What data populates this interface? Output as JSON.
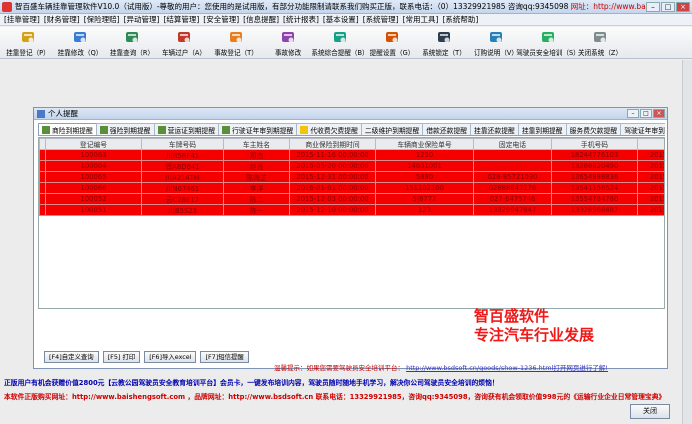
{
  "window": {
    "title_main": "智百盛车辆挂靠管理软件V10.0（试用版）-尊敬的用户：您使用的是试用版，有部分功能限制请联系我们购买正版，联系电话：（0）13329921985  咨询qq:9345098",
    "title_url_label": "网址：http://www.baishengsoft.com"
  },
  "menu": [
    "[挂靠管理]",
    "[财务管理]",
    "[保险理赔]",
    "[异动管理]",
    "[结算管理]",
    "[安全管理]",
    "[信息提醒]",
    "[统计报表]",
    "[基本设置]",
    "[系统管理]",
    "[常用工具]",
    "[系统帮助]"
  ],
  "toolbar": [
    {
      "label": "挂靠登记（P）",
      "icon": "folder-plus-icon"
    },
    {
      "label": "挂靠修改（Q）",
      "icon": "edit-icon"
    },
    {
      "label": "挂靠查询（R）",
      "icon": "magnifier-icon"
    },
    {
      "label": "车辆过户（A）",
      "icon": "car-transfer-icon"
    },
    {
      "label": "事故登记（T）",
      "icon": "accident-icon"
    },
    {
      "label": "事故修改",
      "icon": "accident-edit-icon"
    },
    {
      "label": "系统综合提醒（B）",
      "icon": "reminder-icon"
    },
    {
      "label": "提醒设置（G）",
      "icon": "bell-settings-icon"
    },
    {
      "label": "系统锁定（T）",
      "icon": "lock-icon"
    },
    {
      "label": "订购说明（V）",
      "icon": "info-icon"
    },
    {
      "label": "驾驶员安全培训（S）",
      "icon": "training-icon"
    },
    {
      "label": "关闭系统（Z）",
      "icon": "power-icon"
    }
  ],
  "child_window": {
    "title": "个人提醒",
    "tabs": [
      {
        "label": "商险到期提醒",
        "icon": "doc-icon"
      },
      {
        "label": "强险到期提醒",
        "icon": "doc-icon"
      },
      {
        "label": "营运证到期提醒",
        "icon": "doc-icon"
      },
      {
        "label": "行驶证年审到期提醒",
        "icon": "doc-icon"
      },
      {
        "label": "代收费欠费提醒",
        "icon": "warning-icon"
      },
      {
        "label": "二级维护到期提醒",
        "icon": "none"
      },
      {
        "label": "借款还款提醒",
        "icon": "none"
      },
      {
        "label": "挂靠还款提醒",
        "icon": "none"
      },
      {
        "label": "挂靠到期提醒",
        "icon": "none"
      },
      {
        "label": "服务费欠款提醒",
        "icon": "none"
      },
      {
        "label": "驾驶证年审到",
        "icon": "none"
      }
    ],
    "columns": [
      "登记编号",
      "车牌号码",
      "车主姓名",
      "商业保险到期时间",
      "车辆商业保险单号",
      "固定电话",
      "手机号码",
      ""
    ],
    "rows": [
      [
        "100063",
        "川R5RF41",
        "邓杰",
        "2015-11-16 00:00:00",
        "1250",
        "",
        "18244776103",
        "2015"
      ],
      [
        "100064",
        "晋A8D641",
        "赵亮",
        "2015-05-20 00:00:00",
        "14601001",
        "",
        "13286820490",
        "2015"
      ],
      [
        "100065",
        "川A214TM",
        "陈海芝",
        "2015-12-31 00:00:00",
        "5880",
        "028-85721030",
        "13654888836",
        "2015"
      ],
      [
        "100066",
        "川N67461",
        "李洋",
        "2016-01-01 00:00:00",
        "151102100",
        "02888847178",
        "13541156524",
        "2015"
      ],
      [
        "100052",
        "云C28E17",
        "陈二",
        "2015-12-03 00:00:00",
        "5|6777",
        "027-8475746",
        "13554784780",
        "2015"
      ],
      [
        "100051",
        "川B5S23",
        "陈一",
        "2015-12-10 00:00:00",
        "123",
        "13329947647",
        "13328968487",
        "2015"
      ]
    ],
    "watermark_line1": "智百盛软件",
    "watermark_line2": "专注汽车行业发展",
    "buttons": [
      "[F4]自定义查询",
      "[F5] 打印",
      "[F6]导入excel",
      "[F7]短信提醒"
    ],
    "hint_text": "温馨提示：如果您需要驾驶员安全培训平台：",
    "hint_link": "http://www.bsdsoft.cn/goods/show-1236.html打开网页进行了解!"
  },
  "footer": {
    "line1": "正版用户有机会获赠价值2800元【云教公园驾驶员安全教育培训平台】会员卡，一键发布培训内容，驾驶员随时随地手机学习，解决你公司驾驶员安全培训的烦恼！",
    "line2": "本软件正版购买网址：http://www.baishengsoft.com ，品牌网址：http://www.bsdsoft.cn  联系电话：13329921985，咨询qq:9345098，咨询获有机会领取价值998元的《运输行业企业日常管理宝典》",
    "close_label": "关闭"
  }
}
